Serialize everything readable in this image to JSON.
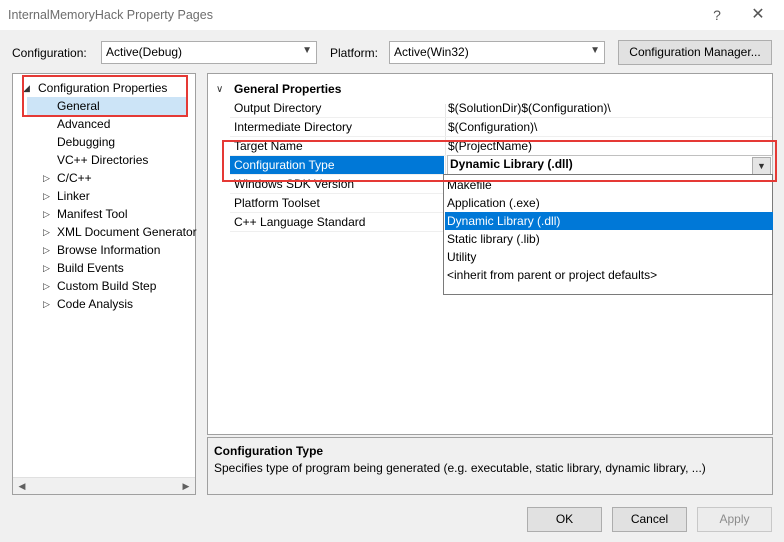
{
  "window": {
    "title": "InternalMemoryHack Property Pages",
    "help_glyph": "?",
    "close_glyph": "✕"
  },
  "config_row": {
    "configuration_label": "Configuration:",
    "configuration_value": "Active(Debug)",
    "platform_label": "Platform:",
    "platform_value": "Active(Win32)",
    "config_manager_label": "Configuration Manager..."
  },
  "tree": {
    "root": {
      "label": "Configuration Properties",
      "expanded": true
    },
    "items": [
      {
        "label": "General",
        "selected": true,
        "expandable": false
      },
      {
        "label": "Advanced",
        "expandable": false
      },
      {
        "label": "Debugging",
        "expandable": false
      },
      {
        "label": "VC++ Directories",
        "expandable": false
      },
      {
        "label": "C/C++",
        "expandable": true
      },
      {
        "label": "Linker",
        "expandable": true
      },
      {
        "label": "Manifest Tool",
        "expandable": true
      },
      {
        "label": "XML Document Generator",
        "expandable": true
      },
      {
        "label": "Browse Information",
        "expandable": true
      },
      {
        "label": "Build Events",
        "expandable": true
      },
      {
        "label": "Custom Build Step",
        "expandable": true
      },
      {
        "label": "Code Analysis",
        "expandable": true
      }
    ]
  },
  "grid": {
    "section_title": "General Properties",
    "rows": [
      {
        "name": "Output Directory",
        "value": "$(SolutionDir)$(Configuration)\\"
      },
      {
        "name": "Intermediate Directory",
        "value": "$(Configuration)\\"
      },
      {
        "name": "Target Name",
        "value": "$(ProjectName)"
      },
      {
        "name": "Configuration Type",
        "value": "Dynamic Library (.dll)",
        "selected": true
      },
      {
        "name": "Windows SDK Version",
        "value": ""
      },
      {
        "name": "Platform Toolset",
        "value": ""
      },
      {
        "name": "C++ Language Standard",
        "value": ""
      }
    ]
  },
  "dropdown": {
    "options": [
      {
        "label": "Makefile"
      },
      {
        "label": "Application (.exe)"
      },
      {
        "label": "Dynamic Library (.dll)",
        "selected": true
      },
      {
        "label": "Static library (.lib)"
      },
      {
        "label": "Utility"
      },
      {
        "label": "<inherit from parent or project defaults>"
      }
    ]
  },
  "description": {
    "title": "Configuration Type",
    "text": "Specifies type of program being generated (e.g. executable, static library, dynamic library, ...)"
  },
  "buttons": {
    "ok": "OK",
    "cancel": "Cancel",
    "apply": "Apply"
  },
  "colors": {
    "selection": "#0078d7",
    "tree_selection": "#cce4f7",
    "annotation_red": "#e53935"
  }
}
